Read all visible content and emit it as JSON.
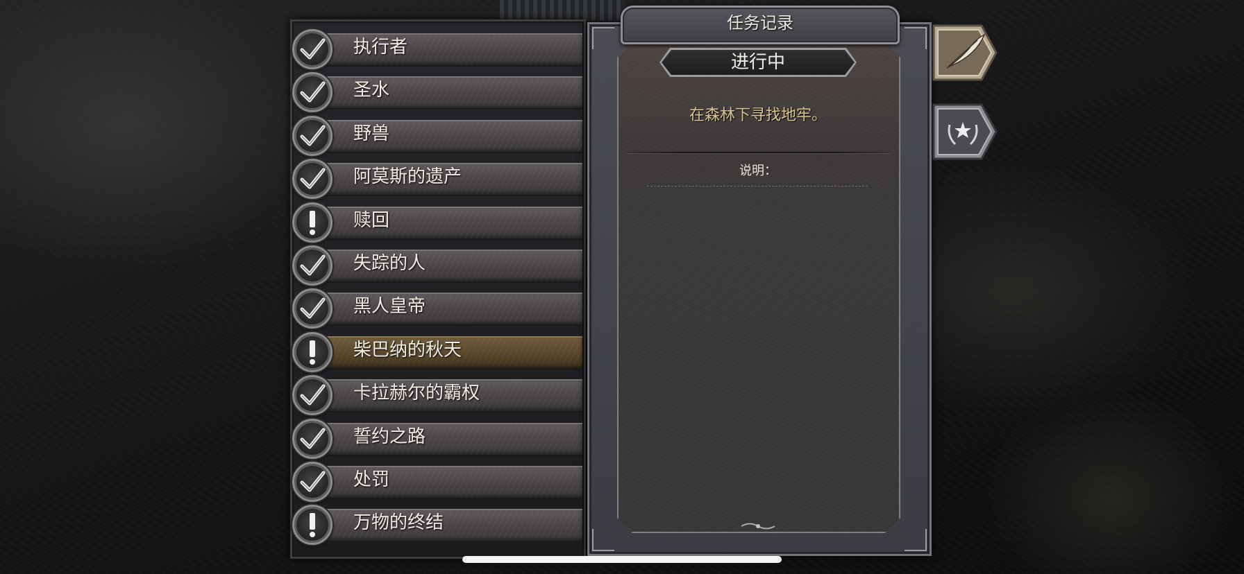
{
  "journal": {
    "title": "任务记录",
    "status": "进行中",
    "objective": "在森林下寻找地牢。",
    "description_label": "说明："
  },
  "quests": [
    {
      "name": "执行者",
      "state": "completed"
    },
    {
      "name": "圣水",
      "state": "completed"
    },
    {
      "name": "野兽",
      "state": "completed"
    },
    {
      "name": "阿莫斯的遗产",
      "state": "completed"
    },
    {
      "name": "赎回",
      "state": "active"
    },
    {
      "name": "失踪的人",
      "state": "completed"
    },
    {
      "name": "黑人皇帝",
      "state": "completed"
    },
    {
      "name": "柴巴纳的秋天",
      "state": "active",
      "selected": true
    },
    {
      "name": "卡拉赫尔的霸权",
      "state": "completed"
    },
    {
      "name": "誓约之路",
      "state": "completed"
    },
    {
      "name": "处罚",
      "state": "completed"
    },
    {
      "name": "万物的终结",
      "state": "active"
    }
  ],
  "side_buttons": [
    {
      "icon": "quill-icon",
      "active": true
    },
    {
      "icon": "star-laurel-icon",
      "active": false
    }
  ],
  "colors": {
    "objective_text": "#d9c38e",
    "selected_row": "#5c4a2e",
    "row": "#4c484b"
  }
}
